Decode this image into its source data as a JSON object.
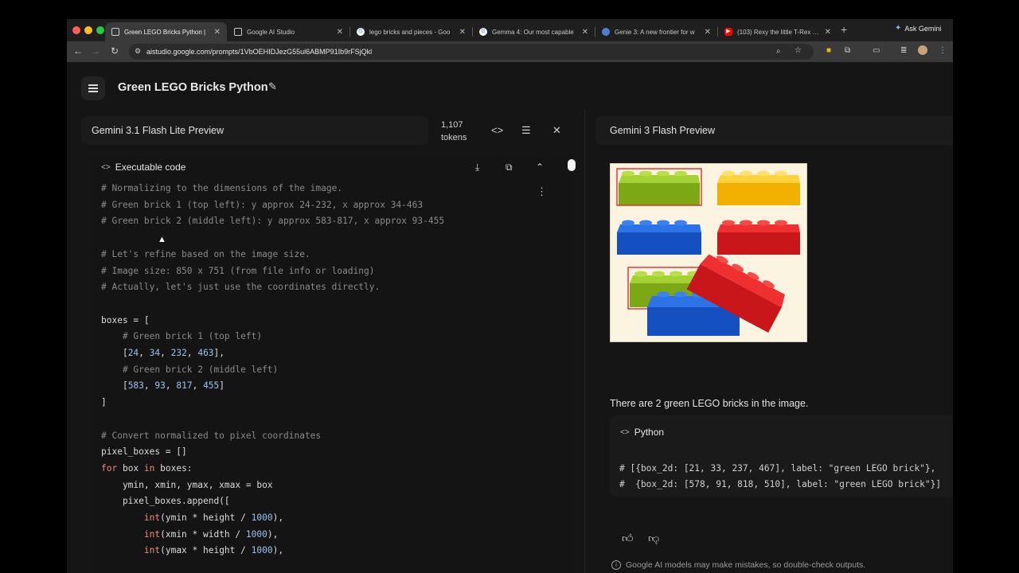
{
  "browser": {
    "tabs": [
      {
        "title": "Green LEGO Bricks Python | ",
        "favicon": "ai-studio-icon",
        "active": true
      },
      {
        "title": "Google AI Studio",
        "favicon": "ai-studio-icon",
        "active": false
      },
      {
        "title": "lego bricks and pieces - Goo",
        "favicon": "google-icon",
        "active": false
      },
      {
        "title": "Gemma 4: Our most capable",
        "favicon": "google-icon",
        "active": false
      },
      {
        "title": "Genie 3: A new frontier for w",
        "favicon": "deepmind-icon",
        "active": false
      },
      {
        "title": "(103) Rexy the little T-Rex - A",
        "favicon": "youtube-icon",
        "active": false
      }
    ],
    "new_tab": "+",
    "ask_gemini": "Ask Gemini",
    "url": "aistudio.google.com/prompts/1VbOEHIDJezG55ul6ABMP91Ib9rFSjQkl"
  },
  "page": {
    "title": "Green LEGO Bricks Python"
  },
  "left_panel": {
    "model": "Gemini 3.1 Flash Lite Preview",
    "token_count": "1,107",
    "token_label": "tokens",
    "code_block_label": "Executable code",
    "code_lines": [
      [
        {
          "t": "# Normalizing to the dimensions of the image.",
          "c": "com"
        }
      ],
      [
        {
          "t": "# Green brick 1 (top left): y approx 24-232, x approx 34-463",
          "c": "com"
        }
      ],
      [
        {
          "t": "# Green brick 2 (middle left): y approx 583-817, x approx 93-455",
          "c": "com"
        }
      ],
      [],
      [
        {
          "t": "# Let's refine based on the image size.",
          "c": "com"
        }
      ],
      [
        {
          "t": "# Image size: 850 x 751 (from file info or loading)",
          "c": "com"
        }
      ],
      [
        {
          "t": "# Actually, let's just use the coordinates directly.",
          "c": "com"
        }
      ],
      [],
      [
        {
          "t": "boxes = [",
          "c": "txt"
        }
      ],
      [
        {
          "t": "    # Green brick 1 (top left)",
          "c": "com"
        }
      ],
      [
        {
          "t": "    [",
          "c": "txt"
        },
        {
          "t": "24",
          "c": "num"
        },
        {
          "t": ", ",
          "c": "txt"
        },
        {
          "t": "34",
          "c": "num"
        },
        {
          "t": ", ",
          "c": "txt"
        },
        {
          "t": "232",
          "c": "num"
        },
        {
          "t": ", ",
          "c": "txt"
        },
        {
          "t": "463",
          "c": "num"
        },
        {
          "t": "],",
          "c": "txt"
        }
      ],
      [
        {
          "t": "    # Green brick 2 (middle left)",
          "c": "com"
        }
      ],
      [
        {
          "t": "    [",
          "c": "txt"
        },
        {
          "t": "583",
          "c": "num"
        },
        {
          "t": ", ",
          "c": "txt"
        },
        {
          "t": "93",
          "c": "num"
        },
        {
          "t": ", ",
          "c": "txt"
        },
        {
          "t": "817",
          "c": "num"
        },
        {
          "t": ", ",
          "c": "txt"
        },
        {
          "t": "455",
          "c": "num"
        },
        {
          "t": "]",
          "c": "txt"
        }
      ],
      [
        {
          "t": "]",
          "c": "txt"
        }
      ],
      [],
      [
        {
          "t": "# Convert normalized to pixel coordinates",
          "c": "com"
        }
      ],
      [
        {
          "t": "pixel_boxes = []",
          "c": "txt"
        }
      ],
      [
        {
          "t": "for",
          "c": "kw"
        },
        {
          "t": " box ",
          "c": "txt"
        },
        {
          "t": "in",
          "c": "kw"
        },
        {
          "t": " boxes:",
          "c": "txt"
        }
      ],
      [
        {
          "t": "    ymin, xmin, ymax, xmax = box",
          "c": "txt"
        }
      ],
      [
        {
          "t": "    pixel_boxes.append([",
          "c": "txt"
        }
      ],
      [
        {
          "t": "        ",
          "c": "txt"
        },
        {
          "t": "int",
          "c": "fn"
        },
        {
          "t": "(ymin * height / ",
          "c": "txt"
        },
        {
          "t": "1000",
          "c": "num"
        },
        {
          "t": "),",
          "c": "txt"
        }
      ],
      [
        {
          "t": "        ",
          "c": "txt"
        },
        {
          "t": "int",
          "c": "fn"
        },
        {
          "t": "(xmin * width / ",
          "c": "txt"
        },
        {
          "t": "1000",
          "c": "num"
        },
        {
          "t": "),",
          "c": "txt"
        }
      ],
      [
        {
          "t": "        ",
          "c": "txt"
        },
        {
          "t": "int",
          "c": "fn"
        },
        {
          "t": "(ymax * height / ",
          "c": "txt"
        },
        {
          "t": "1000",
          "c": "num"
        },
        {
          "t": "),",
          "c": "txt"
        }
      ]
    ]
  },
  "right_panel": {
    "model": "Gemini 3 Flash Preview",
    "answer": "There are 2 green LEGO bricks in the image.",
    "code_block_label": "Python",
    "code_lines": [
      "# [{box_2d: [21, 33, 237, 467], label: \"green LEGO brick\"},",
      "#  {box_2d: [578, 91, 818, 510], label: \"green LEGO brick\"}]"
    ],
    "disclaimer": "Google AI models may make mistakes, so double-check outputs."
  },
  "colors": {
    "lego_green": "#8fbf1e",
    "lego_yellow": "#ffc20e",
    "lego_blue": "#1a5fd0",
    "lego_red": "#e01d1d",
    "bbox": "#e01d1d"
  }
}
